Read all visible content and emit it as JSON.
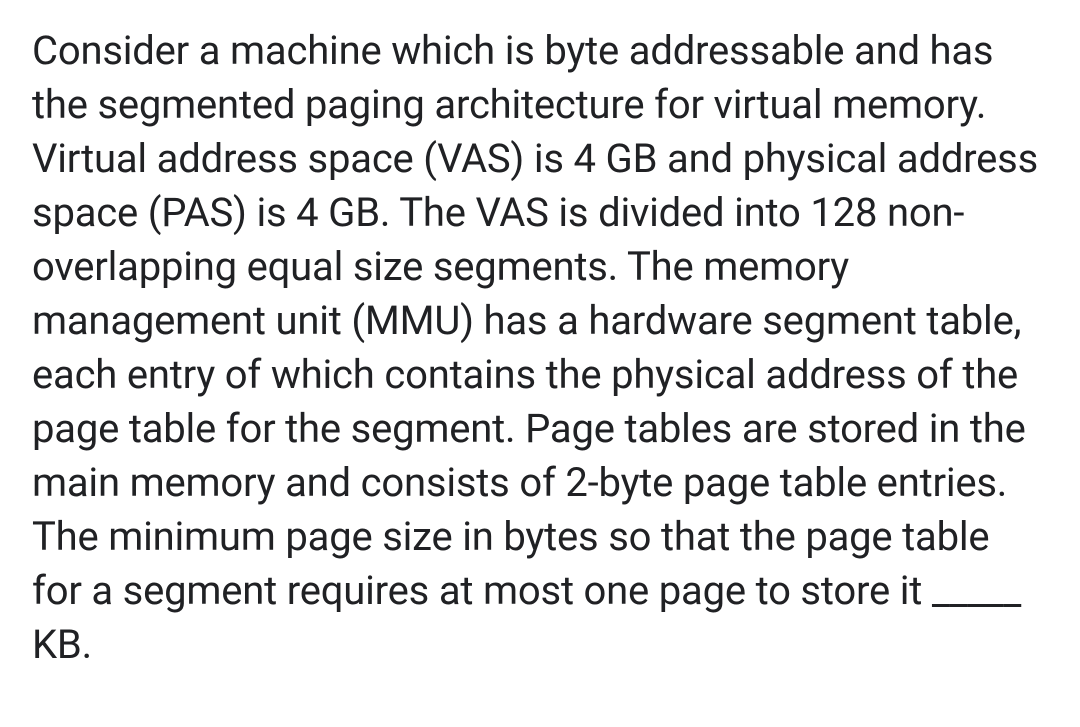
{
  "question": {
    "text": "Consider a machine which is byte addressable and has the segmented paging architecture for virtual memory. Virtual address space (VAS) is 4 GB and physical address space (PAS) is 4 GB. The VAS is divided into 128 non-overlapping equal size segments. The memory management unit (MMU) has a hardware segment table, each entry of which contains the physical address of the page table for the segment. Page tables are stored in the main memory and consists of 2-byte page table entries. The minimum page size in bytes so that the page table for a segment requires at most one page to store it _____ KB."
  }
}
